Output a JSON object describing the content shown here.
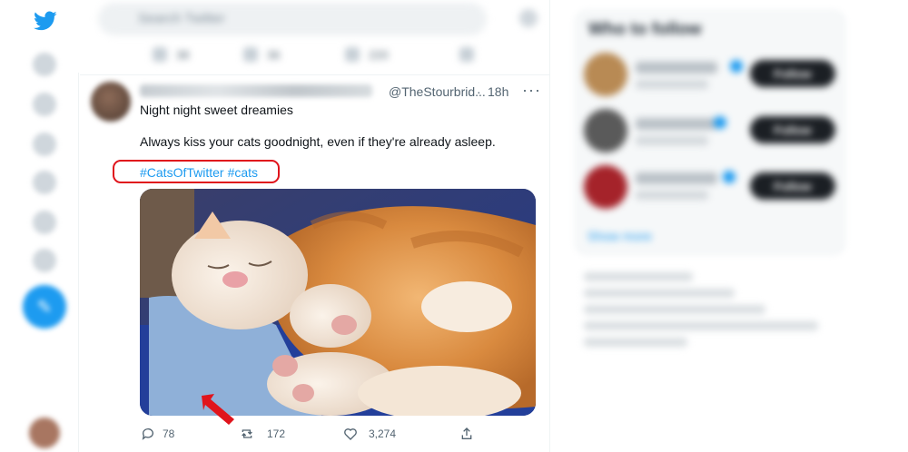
{
  "search": {
    "placeholder": "Search Twitter"
  },
  "previous_tweet_actions": [
    "38",
    "36",
    "220"
  ],
  "tweet": {
    "handle": "@TheStourbrid...",
    "dot": "·",
    "time": "18h",
    "more": "···",
    "text_line1": "Night night sweet dreamies",
    "text_line2": "Always kiss your cats goodnight, even if they're already asleep.",
    "hashtags": [
      "#CatsOfTwitter",
      "#cats"
    ],
    "counts": {
      "replies": "78",
      "retweets": "172",
      "likes": "3,274"
    }
  },
  "sidebar": {
    "title": "Who to follow",
    "follow_label": "Follow",
    "show_more": "Show more"
  },
  "colors": {
    "accent": "#1d9bf0",
    "highlight": "#e0141c"
  }
}
